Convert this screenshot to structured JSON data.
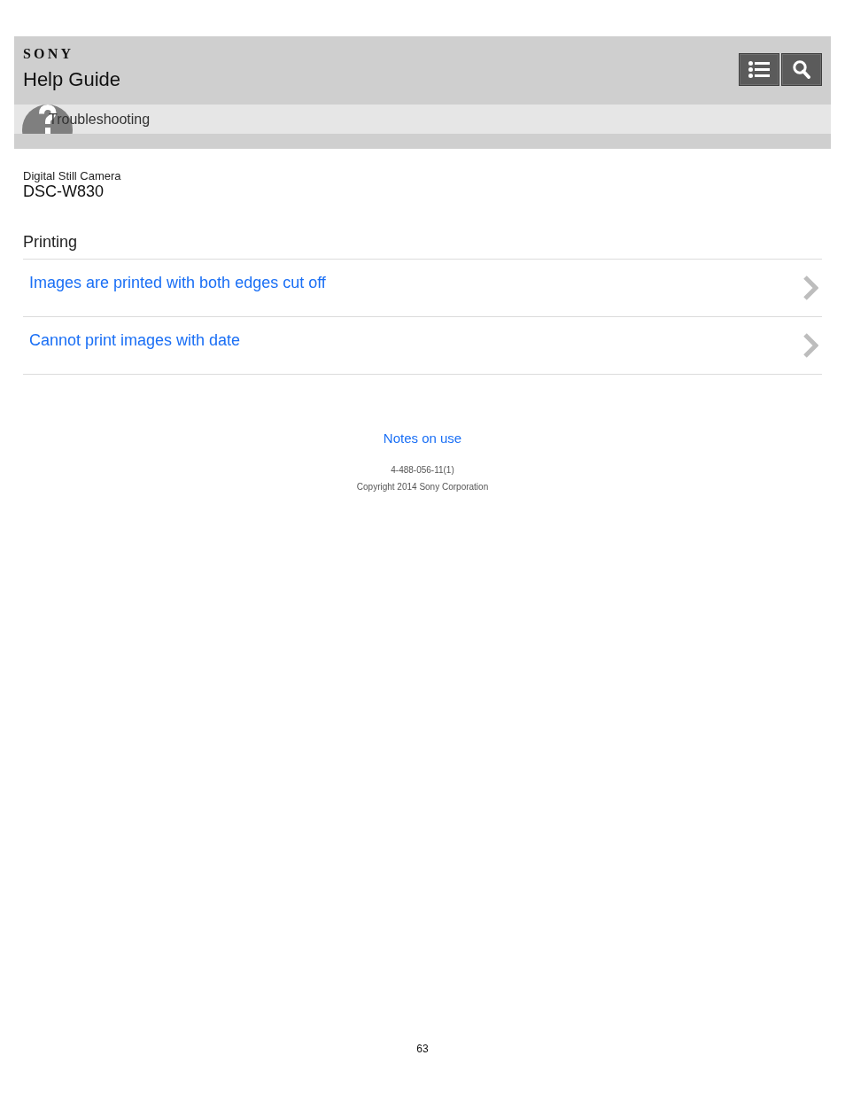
{
  "header": {
    "logo": "SONY",
    "title": "Help Guide"
  },
  "breadcrumb": {
    "label": "Troubleshooting"
  },
  "product": {
    "category": "Digital Still Camera",
    "model": "DSC-W830"
  },
  "section": {
    "title": "Printing",
    "links": [
      "Images are printed with both edges cut off",
      "Cannot print images with date"
    ]
  },
  "footer": {
    "link": "Notes on use",
    "code": "4-488-056-11(1)",
    "copyright": "Copyright 2014 Sony Corporation"
  },
  "page_number": "63"
}
